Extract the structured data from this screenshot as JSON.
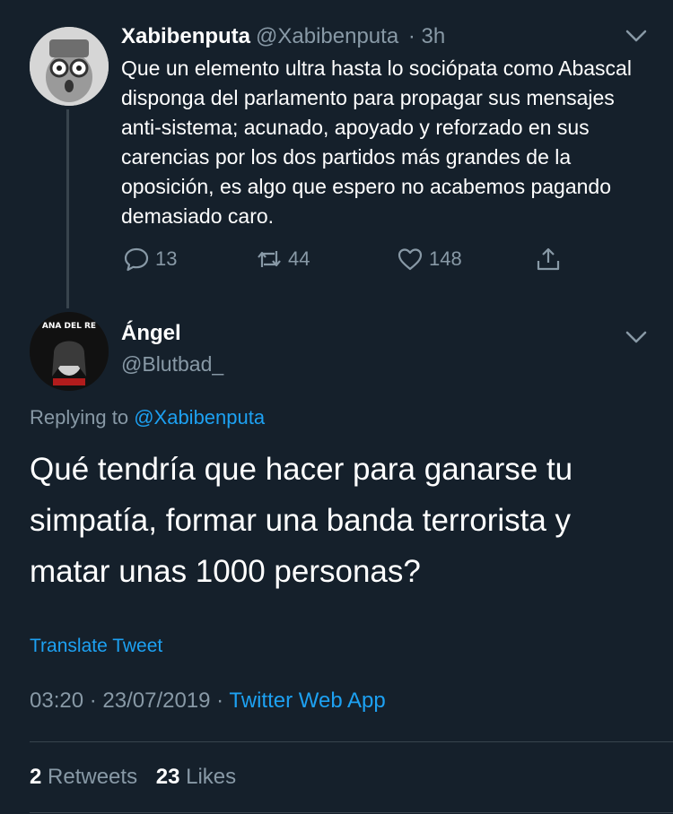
{
  "parent_tweet": {
    "name": "Xabibenputa",
    "handle": "@Xabibenputa",
    "time": "· 3h",
    "text": "Que un elemento ultra hasta lo sociópata como Abascal disponga del parlamento para propagar sus mensajes anti-sistema; acunado, apoyado y reforzado en sus carencias por los dos partidos más grandes de la oposición, es algo que espero no acabemos pagando demasiado caro.",
    "reply_count": "13",
    "retweet_count": "44",
    "like_count": "148",
    "icons": {
      "reply": "reply-icon",
      "retweet": "retweet-icon",
      "like": "heart-icon",
      "share": "share-icon",
      "menu": "chevron-down-icon"
    }
  },
  "focal_tweet": {
    "name": "Ángel",
    "handle": "@Blutbad_",
    "replying_prefix": "Replying to",
    "replying_to": "@Xabibenputa",
    "text": "Qué tendría que hacer para ganarse tu simpatía, formar una banda terrorista y matar unas 1000 personas?",
    "translate_label": "Translate Tweet",
    "timestamp": "03:20 · 23/07/2019 ·",
    "source": "Twitter Web App",
    "retweets_count": "2",
    "retweets_label": "Retweets",
    "likes_count": "23",
    "likes_label": "Likes",
    "avatar_text": "ANA DEL RE"
  },
  "colors": {
    "background": "#15202b",
    "text": "#ffffff",
    "muted": "#8899a6",
    "link": "#1da1f2",
    "divider": "#38444d"
  }
}
